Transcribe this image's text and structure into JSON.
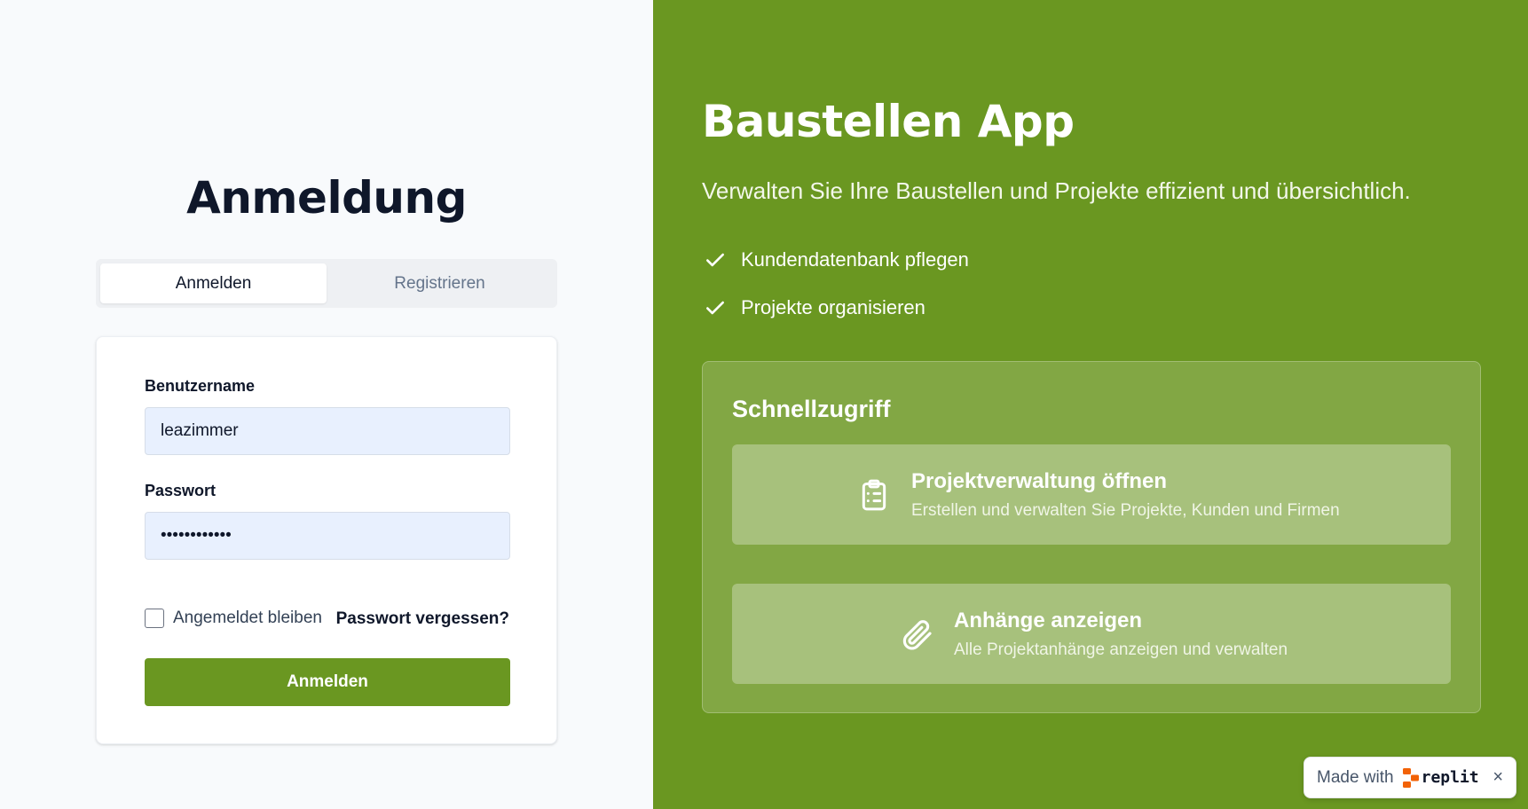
{
  "login": {
    "title": "Anmeldung",
    "tabs": [
      {
        "label": "Anmelden",
        "active": true
      },
      {
        "label": "Registrieren",
        "active": false
      }
    ],
    "username_label": "Benutzername",
    "username_value": "leazimmer",
    "password_label": "Passwort",
    "password_value": "••••••••••••",
    "remember_label": "Angemeldet bleiben",
    "remember_checked": false,
    "forgot_label": "Passwort vergessen?",
    "submit_label": "Anmelden"
  },
  "hero": {
    "title": "Baustellen App",
    "subtitle": "Verwalten Sie Ihre Baustellen und Projekte effizient und übersichtlich.",
    "features": [
      {
        "icon": "check-icon",
        "label": "Kundendatenbank pflegen"
      },
      {
        "icon": "check-icon",
        "label": "Projekte organisieren"
      }
    ],
    "quick_access": {
      "title": "Schnellzugriff",
      "items": [
        {
          "icon": "clipboard-list-icon",
          "title": "Projektverwaltung öffnen",
          "description": "Erstellen und verwalten Sie Projekte, Kunden und Firmen"
        },
        {
          "icon": "paperclip-icon",
          "title": "Anhänge anzeigen",
          "description": "Alle Projektanhänge anzeigen und verwalten"
        }
      ]
    }
  },
  "badge": {
    "text": "Made with",
    "brand": "replit",
    "close": "×"
  },
  "colors": {
    "brand_green": "#6a9721",
    "left_bg": "#f8fafc",
    "input_bg": "#e8f0fe"
  }
}
